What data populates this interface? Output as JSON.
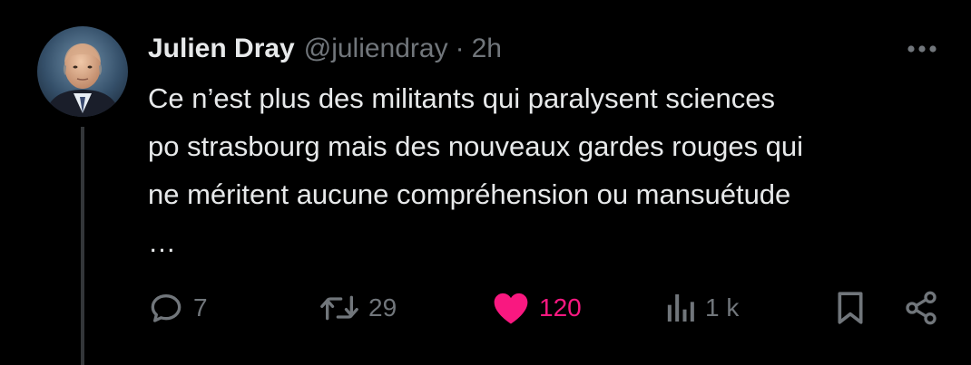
{
  "tweet": {
    "author_name": "Julien Dray",
    "handle": "@juliendray",
    "separator": "·",
    "time": "2h",
    "more_icon": "ellipsis-horizontal",
    "text_lines": [
      "Ce n’est plus des militants qui paralysent sciences",
      "po strasbourg mais des nouveaux gardes rouges qui",
      "ne méritent aucune compréhension ou mansuétude",
      "…"
    ]
  },
  "actions": {
    "reply": {
      "icon": "speech-bubble",
      "count": "7"
    },
    "retweet": {
      "icon": "retweet-arrows",
      "count": "29"
    },
    "like": {
      "icon": "heart-filled",
      "count": "120",
      "active": true
    },
    "views": {
      "icon": "bar-chart",
      "count": "1 k"
    },
    "bookmark": {
      "icon": "bookmark"
    },
    "share": {
      "icon": "share-nodes"
    }
  },
  "colors": {
    "background": "#000000",
    "text": "#e7e9ea",
    "secondary": "#71767b",
    "like": "#f91880",
    "thread_line": "#333639"
  }
}
